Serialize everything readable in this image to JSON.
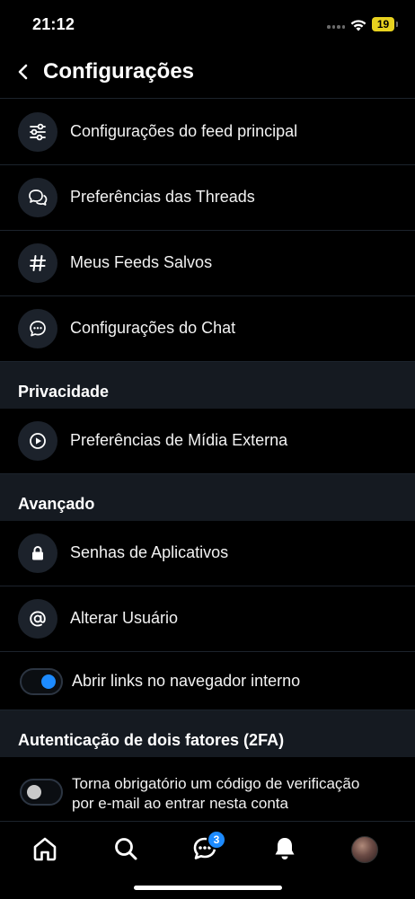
{
  "status_bar": {
    "time": "21:12",
    "battery": "19"
  },
  "header": {
    "title": "Configurações"
  },
  "rows_top": [
    {
      "label": "Configurações do feed principal",
      "icon": "sliders-icon"
    },
    {
      "label": "Preferências das Threads",
      "icon": "chat-bubbles-icon"
    },
    {
      "label": "Meus Feeds Salvos",
      "icon": "hash-icon"
    },
    {
      "label": "Configurações do Chat",
      "icon": "chat-dots-icon"
    }
  ],
  "sections": {
    "privacy": "Privacidade",
    "advanced": "Avançado",
    "twofa": "Autenticação de dois fatores (2FA)"
  },
  "privacy_rows": [
    {
      "label": "Preferências de Mídia Externa",
      "icon": "play-circle-icon"
    }
  ],
  "advanced_rows": [
    {
      "label": "Senhas de Aplicativos",
      "icon": "lock-icon"
    },
    {
      "label": "Alterar Usuário",
      "icon": "at-icon"
    }
  ],
  "toggles": {
    "in_app_browser": {
      "label": "Abrir links no navegador interno",
      "on": true
    },
    "email_2fa": {
      "line1": "Torna obrigatório um código de verificação",
      "line2": "por e-mail ao entrar nesta conta",
      "on": false
    }
  },
  "tabbar": {
    "messages_badge": "3"
  },
  "colors": {
    "accent": "#1d8bff",
    "section_bg": "#151a21",
    "icon_circle": "#1c222b",
    "battery": "#e8d21f"
  }
}
